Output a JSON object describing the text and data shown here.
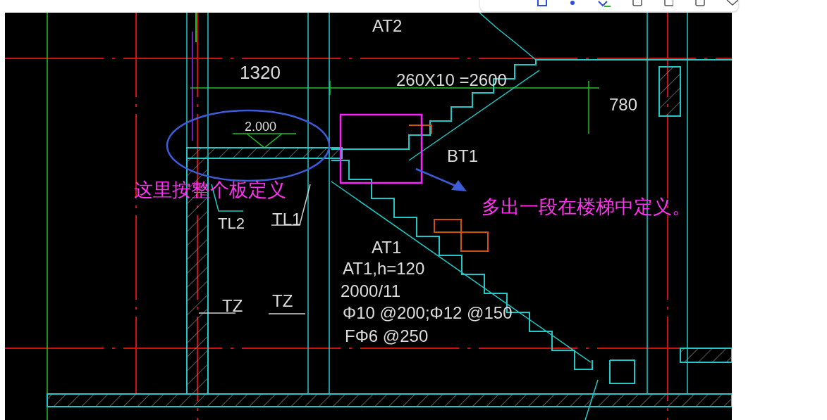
{
  "drawing": {
    "labels": [
      {
        "text": "AT2"
      },
      {
        "text": "1320"
      },
      {
        "text": "260X10 =2600"
      },
      {
        "text": "780"
      },
      {
        "text": "2.000"
      },
      {
        "text": "BT1"
      },
      {
        "text": "TL2"
      },
      {
        "text": "TL1"
      },
      {
        "text": "AT1"
      },
      {
        "text": "AT1,h=120"
      },
      {
        "text": "2000/11"
      },
      {
        "text": "Φ10 @200;Φ12 @150"
      },
      {
        "text": "FΦ6 @250"
      },
      {
        "text": "TZ"
      },
      {
        "text": "TZ"
      }
    ],
    "notes": [
      {
        "text": "这里按整个板定义"
      },
      {
        "text": "多出一段在楼梯中定义。"
      }
    ]
  }
}
